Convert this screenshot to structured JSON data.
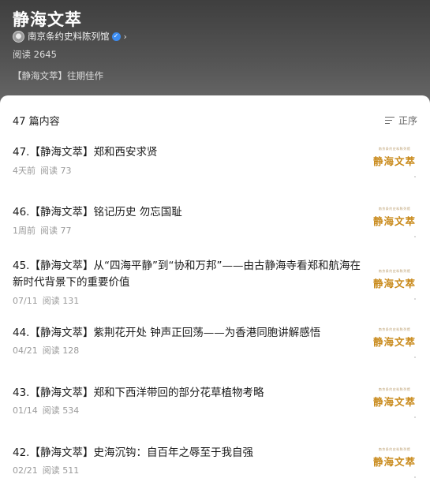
{
  "header": {
    "title": "静海文萃",
    "author": "南京条约史料陈列馆",
    "reads": "阅读 2645",
    "series_link": "【静海文萃】往期佳作"
  },
  "list": {
    "count_label": "47 篇内容",
    "sort_label": "正序",
    "items": [
      {
        "title": "47.【静海文萃】郑和西安求贤",
        "time": "4天前",
        "reads": "阅读 73",
        "thumb_small": "南京条约史料陈列馆",
        "thumb_big": "静海文萃"
      },
      {
        "title": "46.【静海文萃】铭记历史 勿忘国耻",
        "time": "1周前",
        "reads": "阅读 77",
        "thumb_small": "南京条约史料陈列馆",
        "thumb_big": "静海文萃"
      },
      {
        "title": "45.【静海文萃】从“四海平静”到“协和万邦”——由古静海寺看郑和航海在新时代背景下的重要价值",
        "time": "07/11",
        "reads": "阅读 131",
        "thumb_small": "南京条约史料陈列馆",
        "thumb_big": "静海文萃"
      },
      {
        "title": "44.【静海文萃】紫荆花开处 钟声正回荡——为香港同胞讲解感悟",
        "time": "04/21",
        "reads": "阅读 128",
        "thumb_small": "南京条约史料陈列馆",
        "thumb_big": "静海文萃"
      },
      {
        "title": "43.【静海文萃】郑和下西洋带回的部分花草植物考略",
        "time": "01/14",
        "reads": "阅读 534",
        "thumb_small": "南京条约史料陈列馆",
        "thumb_big": "静海文萃"
      },
      {
        "title": "42.【静海文萃】史海沉钩：自百年之辱至于我自强",
        "time": "02/21",
        "reads": "阅读 511",
        "thumb_small": "南京条约史料陈列馆",
        "thumb_big": "静海文萃"
      }
    ]
  },
  "colors": {
    "header_bg": "#4a4a4a",
    "thumb_text": "#c98a1b",
    "verified": "#3d8cf0"
  }
}
